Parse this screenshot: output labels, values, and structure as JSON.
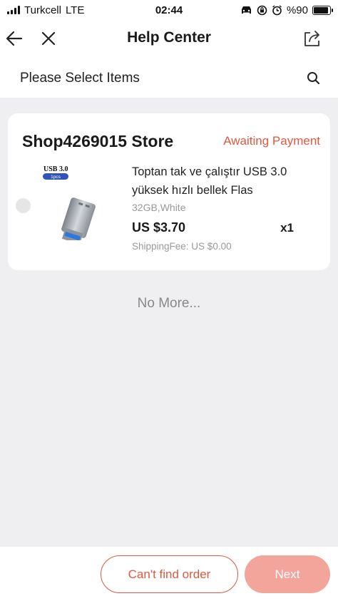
{
  "status_bar": {
    "carrier": "Turkcell",
    "network": "LTE",
    "time": "02:44",
    "battery_text": "%90",
    "battery_level": 0.9,
    "icons": [
      "signal-icon",
      "car-icon",
      "screen-rotation-lock-icon",
      "alarm-icon",
      "battery-icon"
    ]
  },
  "nav": {
    "title": "Help Center",
    "back_icon": "back-arrow-icon",
    "close_icon": "close-icon",
    "share_icon": "share-icon"
  },
  "sub_header": {
    "title": "Please Select Items",
    "search_icon": "search-icon"
  },
  "order": {
    "store_name": "Shop4269015 Store",
    "status": "Awaiting Payment",
    "item": {
      "thumb_label": "USB 3.0",
      "thumb_badge": "1pcs",
      "title": "Toptan tak ve çalıştır USB 3.0 yüksek hızlı bellek Flas",
      "variant": "32GB,White",
      "price": "US $3.70",
      "quantity": "x1",
      "shipping": "ShippingFee: US $0.00"
    }
  },
  "footer_note": "No More...",
  "actions": {
    "cant_find": "Can't find order",
    "next": "Next"
  },
  "colors": {
    "accent": "#e0583f",
    "next_disabled": "#f3a49b",
    "background": "#efeff2"
  }
}
